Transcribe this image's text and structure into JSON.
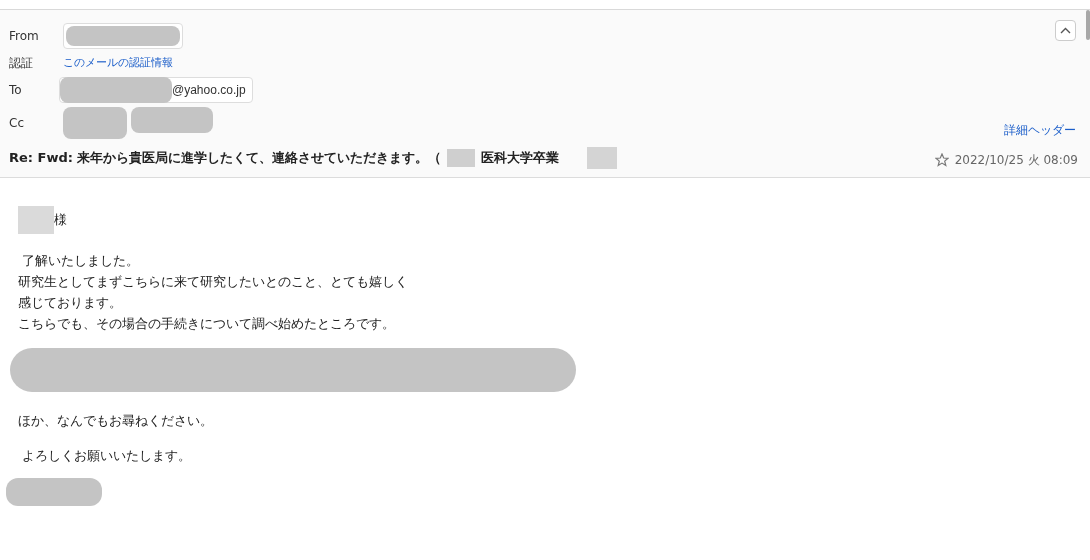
{
  "header": {
    "fields": [
      {
        "label": "From",
        "kind": "redacted"
      },
      {
        "label": "認証",
        "kind": "link",
        "value": "このメールの認証情報"
      },
      {
        "label": "To",
        "kind": "address",
        "value": "@yahoo.co.jp"
      },
      {
        "label": "Cc",
        "kind": "redacted2"
      }
    ],
    "detail_link": "詳細ヘッダー",
    "subject_parts": [
      "Re: Fwd: 来年から貴医局に進学したくて、連絡させていただきます。（",
      "医科大学卒業"
    ],
    "starred": false,
    "date": "2022/10/25 火 08:09"
  },
  "body": {
    "greeting": "様",
    "paragraphs": [
      {
        "kind": "text",
        "lines": [
          " 了解いたしました。",
          "研究生としてまずこちらに来て研究したいとのこと、とても嬉しく",
          "感じております。",
          "こちらでも、その場合の手続きについて調べ始めたところです。"
        ]
      },
      {
        "kind": "redacted"
      },
      {
        "kind": "text",
        "lines": [
          "ほか、なんでもお尋ねください。"
        ]
      },
      {
        "kind": "text",
        "lines": [
          " よろしくお願いいたします。"
        ]
      },
      {
        "kind": "signature"
      }
    ]
  }
}
